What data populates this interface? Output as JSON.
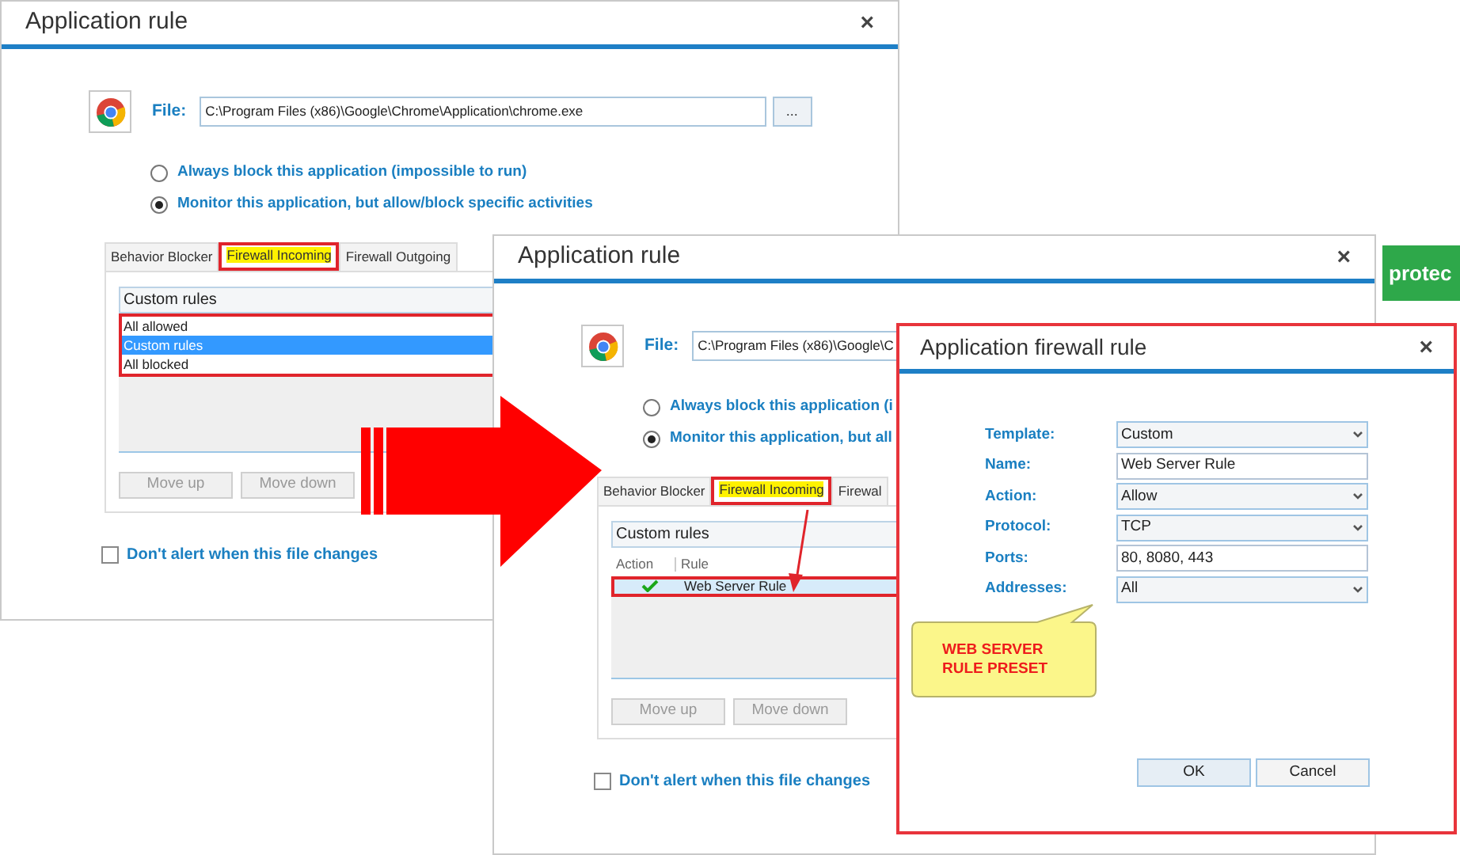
{
  "back_window": {
    "title": "Application rule",
    "close": "×",
    "file_label": "File:",
    "file_path": "C:\\Program Files (x86)\\Google\\Chrome\\Application\\chrome.exe",
    "browse": "...",
    "options": [
      {
        "label": "Always block this application (impossible to run)",
        "selected": false
      },
      {
        "label": "Monitor this application, but allow/block specific activities",
        "selected": true
      }
    ],
    "tabs": [
      {
        "label": "Behavior Blocker",
        "selected": false,
        "highlighted": false
      },
      {
        "label": "Firewall Incoming",
        "selected": true,
        "highlighted": true
      },
      {
        "label": "Firewall Outgoing",
        "selected": false,
        "highlighted": false
      }
    ],
    "rules_dropdown": {
      "value": "Custom rules",
      "expanded": true,
      "highlighted": true,
      "options": [
        {
          "label": "All allowed",
          "selected": false
        },
        {
          "label": "Custom rules",
          "selected": true
        },
        {
          "label": "All blocked",
          "selected": false
        }
      ]
    },
    "buttons": [
      {
        "label": "Move up",
        "disabled": true
      },
      {
        "label": "Move down",
        "disabled": true
      }
    ],
    "dont_alert": {
      "label": "Don't alert when this file changes",
      "checked": false
    }
  },
  "front_window": {
    "title": "Application rule",
    "close": "×",
    "file_label": "File:",
    "file_path": "C:\\Program Files (x86)\\Google\\C",
    "options": [
      {
        "label": "Always block this application (i",
        "selected": false
      },
      {
        "label": "Monitor this application, but all",
        "selected": true
      }
    ],
    "tabs": [
      {
        "label": "Behavior Blocker",
        "selected": false,
        "highlighted": false
      },
      {
        "label": "Firewall Incoming",
        "selected": true,
        "highlighted": true
      },
      {
        "label": "Firewal",
        "selected": false,
        "highlighted": false
      }
    ],
    "rules_dropdown": {
      "value": "Custom rules"
    },
    "rules_table": {
      "columns": [
        "Action",
        "Rule"
      ],
      "rows": [
        {
          "allowed": true,
          "rule": "Web Server Rule",
          "selected": true,
          "highlighted": true
        }
      ]
    },
    "buttons": [
      {
        "label": "Move up",
        "disabled": true
      },
      {
        "label": "Move down",
        "disabled": true
      }
    ],
    "dont_alert": {
      "label": "Don't alert when this file changes",
      "checked": false
    }
  },
  "badge": {
    "text": "protec"
  },
  "firewall_rule_dialog": {
    "title": "Application firewall rule",
    "close": "×",
    "fields": [
      {
        "label": "Template:",
        "kind": "select",
        "value": "Custom"
      },
      {
        "label": "Name:",
        "kind": "text",
        "value": "Web Server Rule"
      },
      {
        "label": "Action:",
        "kind": "select",
        "value": "Allow"
      },
      {
        "label": "Protocol:",
        "kind": "select",
        "value": "TCP"
      },
      {
        "label": "Ports:",
        "kind": "text",
        "value": "80, 8080, 443"
      },
      {
        "label": "Addresses:",
        "kind": "select",
        "value": "All"
      }
    ],
    "callout": "WEB SERVER RULE PRESET",
    "buttons": [
      "OK",
      "Cancel"
    ]
  }
}
